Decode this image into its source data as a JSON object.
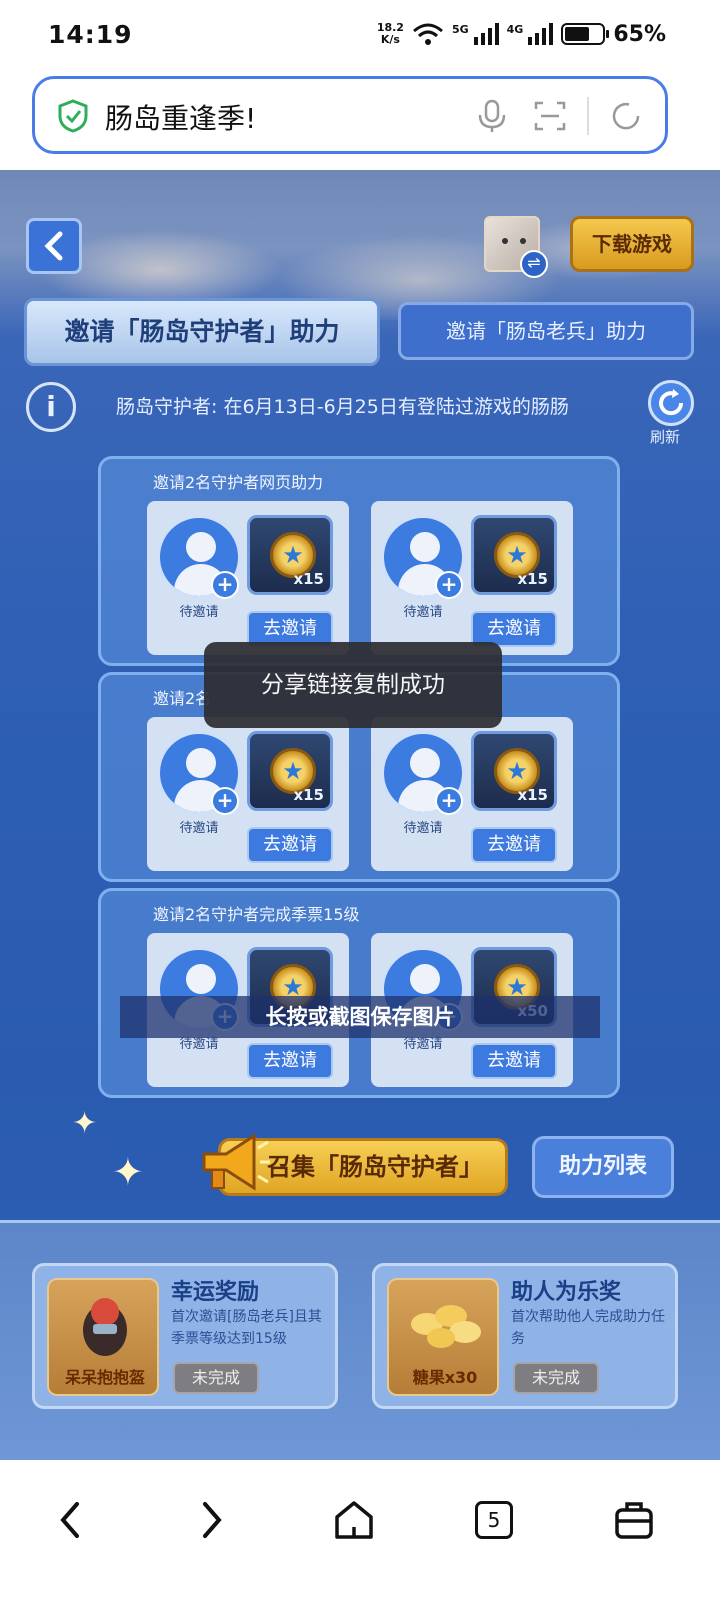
{
  "status_bar": {
    "time": "14:19",
    "net_speed_value": "18.2",
    "net_speed_unit": "K/s",
    "sig1_label": "5G",
    "sig2_label": "4G",
    "battery_level": 0.65,
    "battery_pct": "65%"
  },
  "address_bar": {
    "text": "肠岛重逢季!",
    "icons": [
      "shield-check-icon",
      "microphone-icon",
      "scan-icon",
      "refresh-icon"
    ]
  },
  "header": {
    "download_label": "下载游戏",
    "swap_glyph": "⇌"
  },
  "tabs": [
    {
      "label": "邀请「肠岛守护者」助力",
      "active": true
    },
    {
      "label": "邀请「肠岛老兵」助力",
      "active": false
    }
  ],
  "info": {
    "icon_glyph": "i",
    "text": "肠岛守护者: 在6月13日-6月25日有登陆过游戏的肠肠",
    "refresh_label": "刷新"
  },
  "panels": [
    {
      "title": "邀请2名守护者网页助力",
      "cards": [
        {
          "status": "待邀请",
          "qty": "x15",
          "button": "去邀请"
        },
        {
          "status": "待邀请",
          "qty": "x15",
          "button": "去邀请"
        }
      ]
    },
    {
      "title": "邀请2名",
      "cards": [
        {
          "status": "待邀请",
          "qty": "x15",
          "button": "去邀请"
        },
        {
          "status": "待邀请",
          "qty": "x15",
          "button": "去邀请"
        }
      ]
    },
    {
      "title": "邀请2名守护者完成季票15级",
      "cards": [
        {
          "status": "待邀请",
          "qty": "",
          "button": "去邀请"
        },
        {
          "status": "待邀请",
          "qty": "x50",
          "button": "去邀请"
        }
      ]
    }
  ],
  "card_glyphs": {
    "plus": "+",
    "star": "★"
  },
  "toast": "分享链接复制成功",
  "save_banner": "长按或截图保存图片",
  "actions": {
    "summon_label": "召集「肠岛守护者」",
    "help_list_label": "助力列表"
  },
  "achievements": [
    {
      "title": "幸运奖励",
      "desc": "首次邀请[肠岛老兵]且其季票等级达到15级",
      "item": "呆呆抱抱盔",
      "status": "未完成"
    },
    {
      "title": "助人为乐奖",
      "desc": "首次帮助他人完成助力任务",
      "item": "糖果x30",
      "status": "未完成"
    }
  ],
  "nav": {
    "tab_count": "5",
    "icons": [
      "back-arrow-icon",
      "forward-arrow-icon",
      "home-icon",
      "tabs-icon",
      "bag-icon"
    ]
  },
  "colors": {
    "accent_blue": "#4a7ce8",
    "game_blue": "#2d5fb5",
    "gold_button": "#e0a524",
    "toast_bg": "#2d2d32"
  }
}
